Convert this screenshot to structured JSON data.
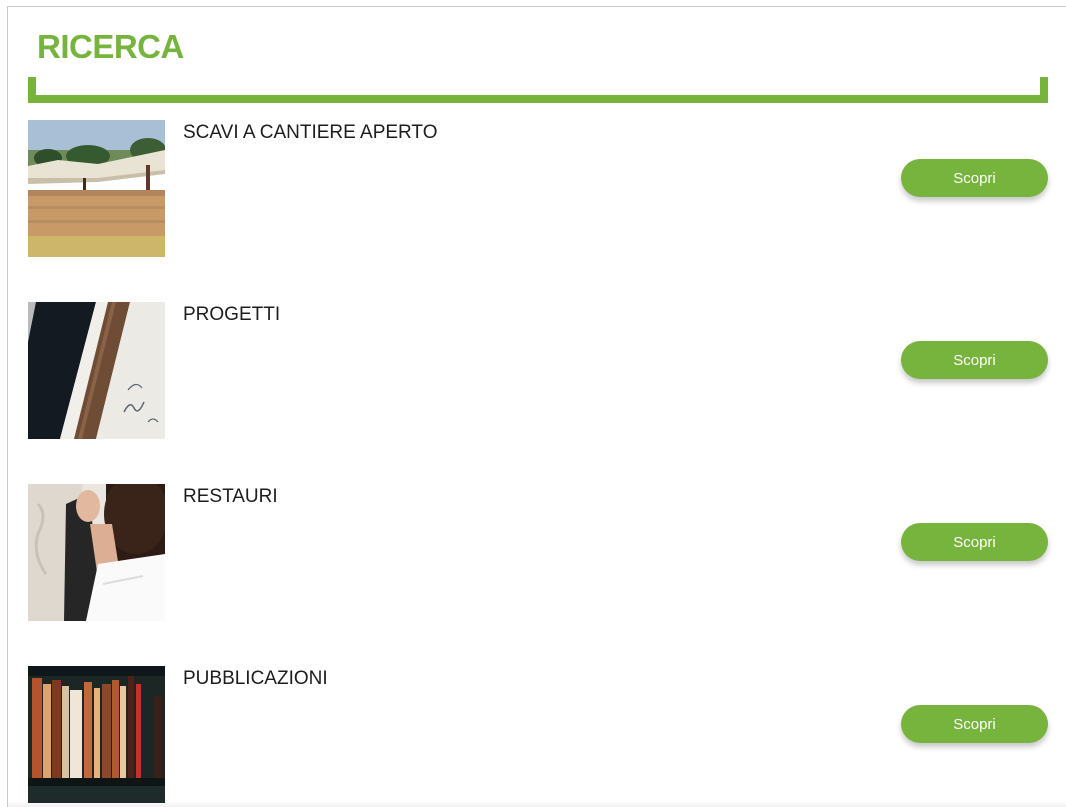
{
  "section": {
    "title": "RICERCA",
    "accent_color": "#77b43e"
  },
  "items": [
    {
      "title": "SCAVI A CANTIERE APERTO",
      "button_label": "Scopri",
      "image": "excavation-site-photo"
    },
    {
      "title": "PROGETTI",
      "button_label": "Scopri",
      "image": "architectural-drawings-photo"
    },
    {
      "title": "RESTAURI",
      "button_label": "Scopri",
      "image": "restoration-work-photo"
    },
    {
      "title": "PUBBLICAZIONI",
      "button_label": "Scopri",
      "image": "bookshelf-photo"
    }
  ]
}
